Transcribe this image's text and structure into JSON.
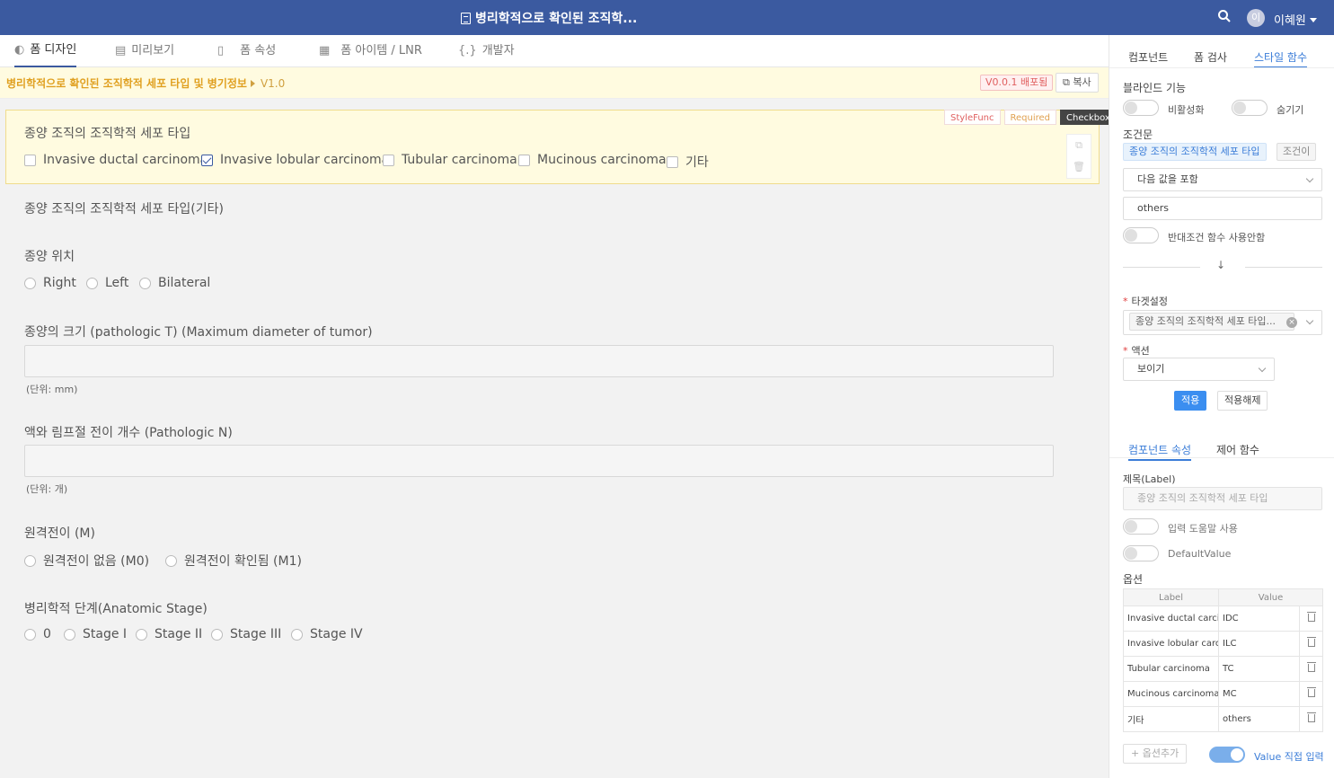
{
  "header": {
    "title": "병리학적으로 확인된 조직학...",
    "user_initials": "이",
    "user_name": "이혜원"
  },
  "tabs": [
    {
      "label": "폼 디자인",
      "icon": "palette-icon"
    },
    {
      "label": "미리보기",
      "icon": "preview-icon"
    },
    {
      "label": "폼 속성",
      "icon": "document-icon"
    },
    {
      "label": "폼 아이템 / LNR",
      "icon": "grid-icon"
    },
    {
      "label": "개발자",
      "icon": "code-icon"
    }
  ],
  "breadcrumb": {
    "path": "병리학적으로 확인된 조직학적 세포 타입 및 병기정보",
    "version": "V1.0",
    "deploy_badge": "V0.0.1 배포됨",
    "copy_label": "복사"
  },
  "selected": {
    "tags": [
      "StyleFunc",
      "Required",
      "Checkbox"
    ]
  },
  "form": {
    "q1": {
      "label": "종양 조직의 조직학적 세포 타입",
      "options": [
        "Invasive ductal carcinoma",
        "Invasive lobular carcinoma",
        "Tubular carcinoma",
        "Mucinous carcinoma",
        "기타"
      ],
      "checked_index": 1
    },
    "q2": {
      "label": "종양 조직의 조직학적 세포 타입(기타)"
    },
    "q3": {
      "label": "종양 위치",
      "options": [
        "Right",
        "Left",
        "Bilateral"
      ]
    },
    "q4": {
      "label": "종양의 크기 (pathologic T) (Maximum diameter of tumor)",
      "unit": "(단위: mm)"
    },
    "q5": {
      "label": "액와 림프절 전이 개수 (Pathologic N)",
      "unit": "(단위: 개)"
    },
    "q6": {
      "label": "원격전이 (M)",
      "options": [
        "원격전이 없음 (M0)",
        "원격전이 확인됨 (M1)"
      ]
    },
    "q7": {
      "label": "병리학적 단계(Anatomic Stage)",
      "options": [
        "0",
        "Stage I",
        "Stage II",
        "Stage III",
        "Stage IV"
      ]
    }
  },
  "right_panel": {
    "tabs": [
      "컴포넌트",
      "폼 검사",
      "스타일 함수"
    ],
    "blind_label": "블라인드 기능",
    "toggle_disable": "비활성화",
    "toggle_hide": "숨기기",
    "condition_label": "조건문",
    "condition_chip": "종양 조직의 조직학적 세포 타입",
    "condition_chip2": "조건이",
    "operator": "다음 값을 포함",
    "value": "others",
    "reverse_label": "반대조건 함수 사용안함",
    "target_label": "타겟설정",
    "target_chip": "종양 조직의 조직학적 세포 타입...",
    "action_label": "액션",
    "action_value": "보이기",
    "apply_btn": "적용",
    "unapply_btn": "적용해제",
    "sub_tabs": [
      "컴포넌트 속성",
      "제어 함수"
    ],
    "title_label": "제목(Label)",
    "title_value": "종양 조직의 조직학적 세포 타입",
    "helper_label": "입력 도움말 사용",
    "default_label": "DefaultValue",
    "options_label": "옵션",
    "table_headers": [
      "Label",
      "Value"
    ],
    "table_rows": [
      {
        "label": "Invasive ductal carcinoma",
        "value": "IDC"
      },
      {
        "label": "Invasive lobular carcinoma",
        "value": "ILC"
      },
      {
        "label": "Tubular carcinoma",
        "value": "TC"
      },
      {
        "label": "Mucinous carcinoma",
        "value": "MC"
      },
      {
        "label": "기타",
        "value": "others"
      }
    ],
    "add_option": "+ 옵션추가",
    "value_direct": "Value 직접 입력"
  }
}
